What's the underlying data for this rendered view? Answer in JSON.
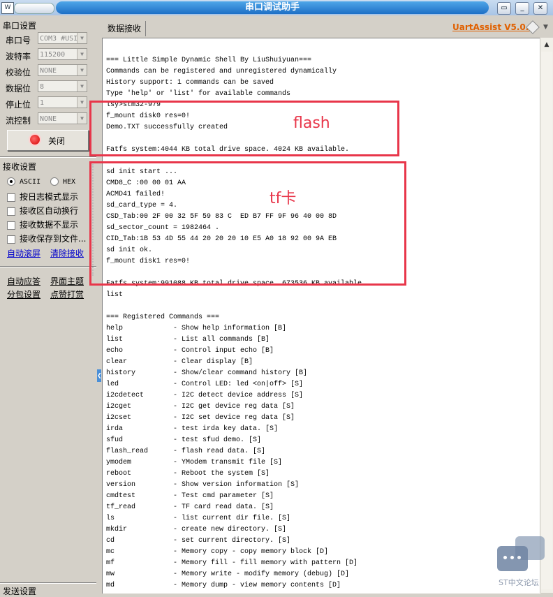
{
  "window": {
    "title": "串口调试助手",
    "sys_icon": "W"
  },
  "left": {
    "serial_group": "串口设置",
    "rows": [
      {
        "label": "串口号",
        "value": "COM3 #USI"
      },
      {
        "label": "波特率",
        "value": "115200"
      },
      {
        "label": "校验位",
        "value": "NONE"
      },
      {
        "label": "数据位",
        "value": "8"
      },
      {
        "label": "停止位",
        "value": "1"
      },
      {
        "label": "流控制",
        "value": "NONE"
      }
    ],
    "close_button": "关闭",
    "recv_group": "接收设置",
    "ascii": "ASCII",
    "hex": "HEX",
    "checks": [
      "按日志模式显示",
      "接收区自动换行",
      "接收数据不显示",
      "接收保存到文件..."
    ],
    "auto_scroll": "自动滚屏",
    "clear_recv": "清除接收",
    "auto_reply": "自动应答",
    "ui_theme": "界面主题",
    "packet_settings": "分包设置",
    "like": "点赞打赏",
    "send_group": "发送设置"
  },
  "tabs": {
    "data_recv": "数据接收"
  },
  "brand": "UartAssist V5.0.1",
  "recv_lines": [
    "",
    "=== Little Simple Dynamic Shell By LiuShuiyuan===",
    "Commands can be registered and unregistered dynamically",
    "History support: 1 commands can be saved",
    "Type 'help' or 'list' for available commands",
    "lsy>stm32-979",
    "f_mount disk0 res=0!",
    "Demo.TXT successfully created",
    "",
    "Fatfs system:4044 KB total drive space. 4024 KB available.",
    "",
    "sd init start ...",
    "CMD8_C :00 00 01 AA",
    "ACMD41 failed!",
    "sd_card_type = 4.",
    "CSD_Tab:00 2F 00 32 5F 59 83 C  ED B7 FF 9F 96 40 00 8D",
    "sd_sector_count = 1982464 .",
    "CID_Tab:1B 53 4D 55 44 20 20 20 10 E5 A0 18 92 00 9A EB",
    "sd init ok.",
    "f_mount disk1 res=0!",
    "",
    "Fatfs system:991088 KB total drive space. 673536 KB available.",
    "list",
    "",
    "=== Registered Commands ===",
    "help            - Show help information [B]",
    "list            - List all commands [B]",
    "echo            - Control input echo [B]",
    "clear           - Clear display [B]",
    "history         - Show/clear command history [B]",
    "led             - Control LED: led <on|off> [S]",
    "i2cdetect       - I2C detect device address [S]",
    "i2cget          - I2C get device reg data [S]",
    "i2cset          - I2C set device reg data [S]",
    "irda            - test irda key data. [S]",
    "sfud            - test sfud demo. [S]",
    "flash_read      - flash read data. [S]",
    "ymodem          - YModem transmit file [S]",
    "reboot          - Reboot the system [S]",
    "version         - Show version information [S]",
    "cmdtest         - Test cmd parameter [S]",
    "tf_read         - TF card read data. [S]",
    "ls              - list current dir file. [S]",
    "mkdir           - create new directory. [S]",
    "cd              - set current directory. [S]",
    "mc              - Memory copy - copy memory block [D]",
    "mf              - Memory fill - fill memory with pattern [D]",
    "mw              - Memory write - modify memory (debug) [D]",
    "md              - Memory dump - view memory contents [D]"
  ],
  "annotations": {
    "flash": "flash",
    "tf": "tf卡",
    "color": "#e8364a"
  },
  "watermark": "ST中文论坛"
}
